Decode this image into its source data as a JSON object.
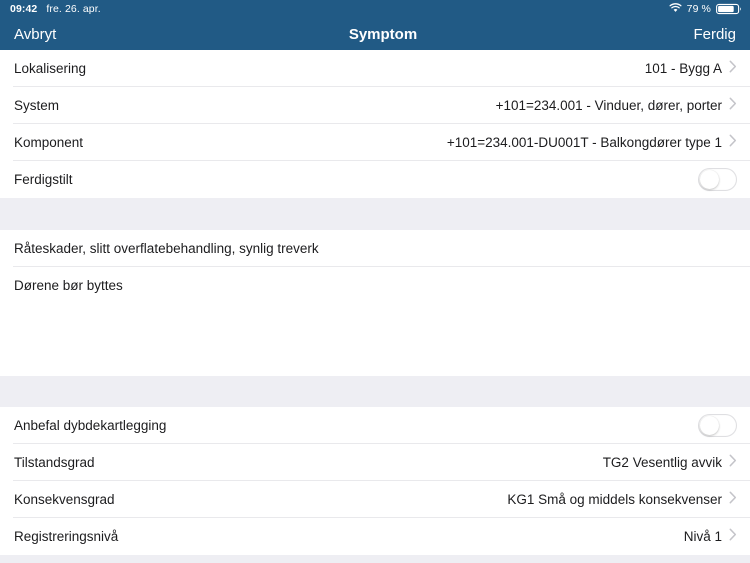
{
  "status_bar": {
    "time": "09:42",
    "date": "fre. 26. apr.",
    "wifi_icon": "wifi-icon",
    "battery_percent": "79 %",
    "battery_level": 79,
    "battery_icon": "battery-icon"
  },
  "nav_bar": {
    "cancel_label": "Avbryt",
    "title": "Symptom",
    "done_label": "Ferdig",
    "background_color": "#215a85",
    "text_color": "#ffffff"
  },
  "section_top": {
    "rows": [
      {
        "label": "Lokalisering",
        "value": "101 - Bygg A",
        "accessory": "chevron-right-icon"
      },
      {
        "label": "System",
        "value": "+101=234.001 - Vinduer, dører, porter",
        "accessory": "chevron-right-icon"
      },
      {
        "label": "Komponent",
        "value": "+101=234.001-DU001T - Balkongdører type 1",
        "accessory": "chevron-right-icon"
      },
      {
        "label": "Ferdigstilt",
        "value": "",
        "accessory": "toggle-switch",
        "toggle_on": false
      }
    ]
  },
  "section_notes": {
    "rows": [
      {
        "text": "Råteskader, slitt overflatebehandling, synlig treverk"
      },
      {
        "text": "Dørene bør byttes"
      }
    ]
  },
  "section_bottom": {
    "rows": [
      {
        "label": "Anbefal dybdekartlegging",
        "value": "",
        "accessory": "toggle-switch",
        "toggle_on": false
      },
      {
        "label": "Tilstandsgrad",
        "value": "TG2 Vesentlig avvik",
        "accessory": "chevron-right-icon"
      },
      {
        "label": "Konsekvensgrad",
        "value": "KG1 Små og middels konsekvenser",
        "accessory": "chevron-right-icon"
      },
      {
        "label": "Registreringsnivå",
        "value": "Nivå 1",
        "accessory": "chevron-right-icon"
      }
    ]
  },
  "colors": {
    "header": "#215a85",
    "section_gap": "#eeeef3",
    "row_background": "#ffffff",
    "separator": "#e9e9ec",
    "text_primary": "#1c1c1e",
    "chevron": "#c4c4c9"
  }
}
